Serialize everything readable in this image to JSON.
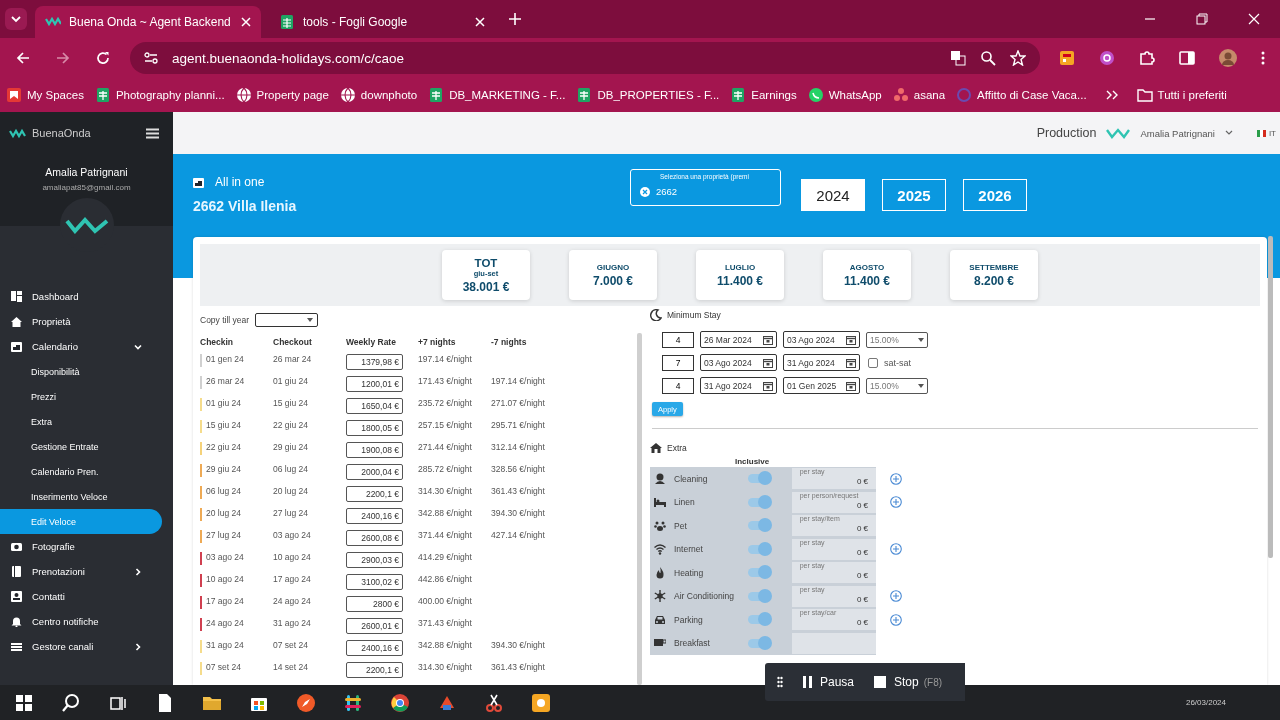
{
  "browser": {
    "tabs": [
      {
        "title": "Buena Onda ~ Agent Backend",
        "selected": true
      },
      {
        "title": "tools - Fogli Google",
        "selected": false
      }
    ],
    "url": "agent.buenaonda-holidays.com/c/caoe",
    "bookmarks": [
      "My Spaces",
      "Photography planni...",
      "Property page",
      "downphoto",
      "DB_MARKETING - F...",
      "DB_PROPERTIES - F...",
      "Earnings",
      "WhatsApp",
      "asana",
      "Affitto di Case Vaca..."
    ],
    "all_bookmarks": "Tutti i preferiti"
  },
  "sidebar": {
    "brand": "BuenaOnda",
    "user_name": "Amalia Patrignani",
    "user_email": "amaliapat85@gmail.com",
    "items": [
      {
        "label": "Dashboard",
        "selected": false
      },
      {
        "label": "Proprietà",
        "selected": false
      },
      {
        "label": "Calendario",
        "selected": false,
        "expanded": true,
        "children": [
          {
            "label": "Disponibilità",
            "selected": false
          },
          {
            "label": "Prezzi",
            "selected": false
          },
          {
            "label": "Extra",
            "selected": false
          },
          {
            "label": "Gestione Entrate",
            "selected": false
          },
          {
            "label": "Calendario Pren.",
            "selected": false
          },
          {
            "label": "Inserimento Veloce",
            "selected": false
          },
          {
            "label": "Edit Veloce",
            "selected": true
          }
        ]
      },
      {
        "label": "Fotografie",
        "selected": false
      },
      {
        "label": "Prenotazioni",
        "selected": false,
        "expanded": false
      },
      {
        "label": "Contatti",
        "selected": false
      },
      {
        "label": "Centro notifiche",
        "selected": false
      },
      {
        "label": "Gestore canali",
        "selected": false,
        "expanded": false
      }
    ]
  },
  "topbar": {
    "environment": "Production",
    "user": "Amalia Patrignani",
    "language": "IT"
  },
  "header": {
    "mode": "All in one",
    "property": "2662 Villa Ilenia",
    "selector_label": "Seleziona una proprietà (premi",
    "selector_value": "2662",
    "years": [
      {
        "label": "2024",
        "selected": true
      },
      {
        "label": "2025",
        "selected": false
      },
      {
        "label": "2026",
        "selected": false
      }
    ]
  },
  "summary": [
    {
      "title": "TOT",
      "subtitle": "giu-set",
      "amount": "38.001 €"
    },
    {
      "title": "GIUGNO",
      "amount": "7.000 €"
    },
    {
      "title": "LUGLIO",
      "amount": "11.400 €"
    },
    {
      "title": "AGOSTO",
      "amount": "11.400 €"
    },
    {
      "title": "SETTEMBRE",
      "amount": "8.200 €"
    }
  ],
  "copy_till_year": "Copy till year",
  "table": {
    "columns": [
      "Checkin",
      "Checkout",
      "Weekly Rate",
      "+7 nights",
      "-7 nights"
    ],
    "rows": [
      {
        "checkin": "01 gen 24",
        "checkout": "26 mar 24",
        "weekly_rate": "1379,98 €",
        "plus7": "197.14 €/night",
        "color": "#d0d0d0"
      },
      {
        "checkin": "26 mar 24",
        "checkout": "01 giu 24",
        "weekly_rate": "1200,01 €",
        "plus7": "171.43 €/night",
        "minus7": "197.14 €/night",
        "color": "#d0d0d0"
      },
      {
        "checkin": "01 giu 24",
        "checkout": "15 giu 24",
        "weekly_rate": "1650,04 €",
        "plus7": "235.72 €/night",
        "minus7": "271.07 €/night",
        "color": "#f5dc8c"
      },
      {
        "checkin": "15 giu 24",
        "checkout": "22 giu 24",
        "weekly_rate": "1800,05 €",
        "plus7": "257.15 €/night",
        "minus7": "295.71 €/night",
        "color": "#f5dc8c"
      },
      {
        "checkin": "22 giu 24",
        "checkout": "29 giu 24",
        "weekly_rate": "1900,08 €",
        "plus7": "271.44 €/night",
        "minus7": "312.14 €/night",
        "color": "#f5d27a"
      },
      {
        "checkin": "29 giu 24",
        "checkout": "06 lug 24",
        "weekly_rate": "2000,04 €",
        "plus7": "285.72 €/night",
        "minus7": "328.56 €/night",
        "color": "#eeaa55"
      },
      {
        "checkin": "06 lug 24",
        "checkout": "20 lug 24",
        "weekly_rate": "2200,1 €",
        "plus7": "314.30 €/night",
        "minus7": "361.43 €/night",
        "color": "#eeaa55"
      },
      {
        "checkin": "20 lug 24",
        "checkout": "27 lug 24",
        "weekly_rate": "2400,16 €",
        "plus7": "342.88 €/night",
        "minus7": "394.30 €/night",
        "color": "#eeaa55"
      },
      {
        "checkin": "27 lug 24",
        "checkout": "03 ago 24",
        "weekly_rate": "2600,08 €",
        "plus7": "371.44 €/night",
        "minus7": "427.14 €/night",
        "color": "#eeaa55"
      },
      {
        "checkin": "03 ago 24",
        "checkout": "10 ago 24",
        "weekly_rate": "2900,03 €",
        "plus7": "414.29 €/night",
        "color": "#d04050"
      },
      {
        "checkin": "10 ago 24",
        "checkout": "17 ago 24",
        "weekly_rate": "3100,02 €",
        "plus7": "442.86 €/night",
        "color": "#d04050"
      },
      {
        "checkin": "17 ago 24",
        "checkout": "24 ago 24",
        "weekly_rate": "2800 €",
        "plus7": "400.00 €/night",
        "color": "#d04050"
      },
      {
        "checkin": "24 ago 24",
        "checkout": "31 ago 24",
        "weekly_rate": "2600,01 €",
        "plus7": "371.43 €/night",
        "color": "#d04050"
      },
      {
        "checkin": "31 ago 24",
        "checkout": "07 set 24",
        "weekly_rate": "2400,16 €",
        "plus7": "342.88 €/night",
        "minus7": "394.30 €/night",
        "color": "#f5dc8c"
      },
      {
        "checkin": "07 set 24",
        "checkout": "14 set 24",
        "weekly_rate": "2200,1 €",
        "plus7": "314.30 €/night",
        "minus7": "361.43 €/night",
        "color": "#f5dc8c"
      }
    ]
  },
  "minimum_stay": {
    "title": "Minimum Stay",
    "rules": [
      {
        "nights": "4",
        "from": "26 Mar 2024",
        "to": "03 Ago 2024",
        "kind": "discount",
        "discount": "15.00%"
      },
      {
        "nights": "7",
        "from": "03 Ago 2024",
        "to": "31 Ago 2024",
        "kind": "checkbox",
        "label": "sat-sat",
        "checked": false
      },
      {
        "nights": "4",
        "from": "31 Ago 2024",
        "to": "01 Gen 2025",
        "kind": "discount",
        "discount": "15.00%"
      }
    ],
    "apply": "Apply"
  },
  "extras": {
    "title": "Extra",
    "column": "Inclusive",
    "items": [
      {
        "name": "Cleaning",
        "inclusive": true,
        "unit": "per stay",
        "price": "0 €",
        "addable": true
      },
      {
        "name": "Linen",
        "inclusive": true,
        "unit": "per person/request",
        "price": "0 €",
        "addable": true
      },
      {
        "name": "Pet",
        "inclusive": true,
        "unit": "per stay/item",
        "price": "0 €",
        "addable": false
      },
      {
        "name": "Internet",
        "inclusive": true,
        "unit": "per stay",
        "price": "0 €",
        "addable": true
      },
      {
        "name": "Heating",
        "inclusive": true,
        "unit": "per stay",
        "price": "0 €",
        "addable": false
      },
      {
        "name": "Air Conditioning",
        "inclusive": true,
        "unit": "per stay",
        "price": "0 €",
        "addable": true
      },
      {
        "name": "Parking",
        "inclusive": true,
        "unit": "per stay/car",
        "price": "0 €",
        "addable": true
      },
      {
        "name": "Breakfast",
        "inclusive": true,
        "addable": false
      }
    ]
  },
  "recorder": {
    "pause": "Pausa",
    "stop": "Stop",
    "shortcut": "(F8)"
  },
  "taskbar": {
    "date": "26/03/2024"
  }
}
